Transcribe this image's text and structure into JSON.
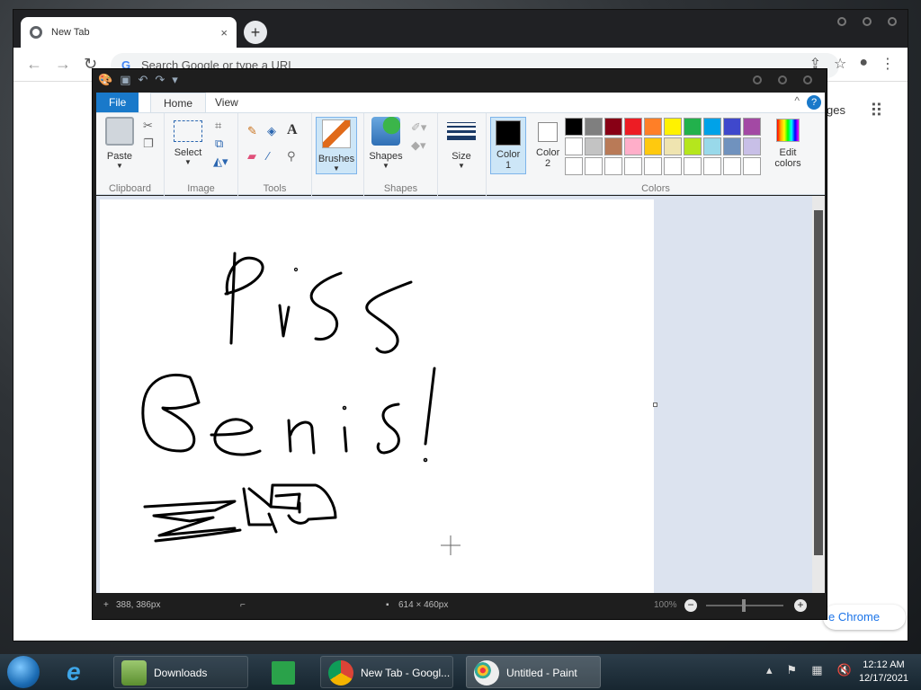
{
  "chrome": {
    "tab_title": "New Tab",
    "tab_close": "×",
    "new_tab": "+",
    "omnibox_placeholder": "Search Google or type a URL",
    "images_link_partial": "ges",
    "customize_partial": "e Chrome"
  },
  "paint": {
    "title_icons": [
      "paint-app-icon",
      "save-icon",
      "undo-icon",
      "redo-icon",
      "dropdown-icon"
    ],
    "tabs": {
      "file": "File",
      "home": "Home",
      "view": "View"
    },
    "help": "?",
    "groups": {
      "clipboard": {
        "label": "Clipboard",
        "paste": "Paste"
      },
      "image": {
        "label": "Image",
        "select": "Select"
      },
      "tools": {
        "label": "Tools"
      },
      "brushes": {
        "label": "Brushes"
      },
      "shapes": {
        "label": "Shapes",
        "shapes_btn": "Shapes"
      },
      "size": {
        "label": "Size"
      },
      "colors": {
        "label": "Colors",
        "color1": "Color 1",
        "color2": "Color 2",
        "edit": "Edit colors",
        "color1_value": "#000000",
        "color2_value": "#ffffff",
        "palette_row1": [
          "#000000",
          "#7f7f7f",
          "#880015",
          "#ed1c24",
          "#ff7f27",
          "#fff200",
          "#22b14c",
          "#00a2e8",
          "#3f48cc",
          "#a349a4"
        ],
        "palette_row2": [
          "#ffffff",
          "#c3c3c3",
          "#b97a57",
          "#ffaec9",
          "#ffc90e",
          "#efe4b0",
          "#b5e61d",
          "#99d9ea",
          "#7092be",
          "#c8bfe7"
        ],
        "palette_row3": [
          "#ffffff",
          "#ffffff",
          "#ffffff",
          "#ffffff",
          "#ffffff",
          "#ffffff",
          "#ffffff",
          "#ffffff",
          "#ffffff",
          "#ffffff"
        ]
      }
    },
    "status": {
      "cursor_pos": "388, 386px",
      "canvas_size": "614 × 460px",
      "zoom": "100%"
    }
  },
  "taskbar": {
    "items": {
      "downloads": "Downloads",
      "chrome": "New Tab - Googl...",
      "paint": "Untitled - Paint"
    },
    "clock_time": "12:12 AM",
    "clock_date": "12/17/2021"
  }
}
